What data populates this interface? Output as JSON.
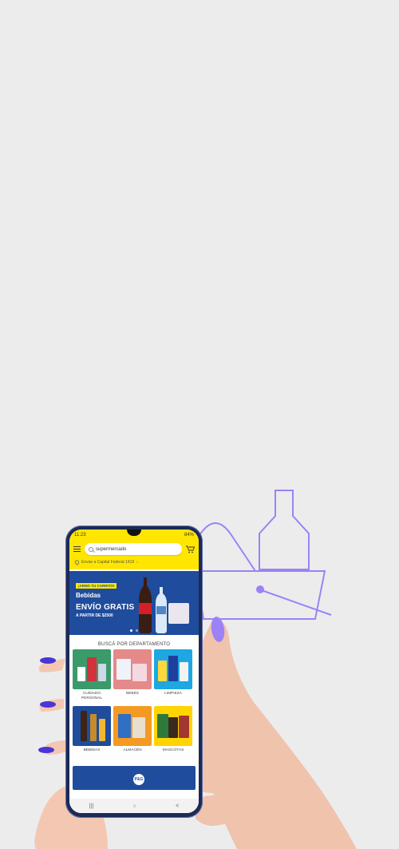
{
  "phone": {
    "status": {
      "time": "11:23",
      "battery": "84%"
    },
    "search": {
      "value": "supermercado",
      "placeholder": ""
    },
    "address": "Enviar a Capital Federal 1419",
    "banner": {
      "tag": "¡ARMÁ TU CARRITO!",
      "title": "Bebidas",
      "headline": "ENVÍO GRATIS",
      "subline": "A PARTIR DE $2500",
      "slide_active": 1,
      "slide_count": 2
    },
    "departments": {
      "title": "BUSCÁ POR DEPARTAMENTO",
      "items": [
        {
          "label": "CUIDADO PERSONAL",
          "color": "#3a9a6a"
        },
        {
          "label": "BEBÉS",
          "color": "#e48a8a"
        },
        {
          "label": "LIMPIEZA",
          "color": "#1ea7e0"
        },
        {
          "label": "BEBIDAS",
          "color": "#1f4c9c"
        },
        {
          "label": "ALMACÉN",
          "color": "#f49a23"
        },
        {
          "label": "MASCOTAS",
          "color": "#ffd400"
        }
      ]
    },
    "promo_brand": "P&G",
    "navbar": {
      "recent": "|||",
      "home": "○",
      "back": "<"
    }
  },
  "colors": {
    "brand_yellow": "#ffe600",
    "brand_blue": "#1f4c9c",
    "accent_purple": "#9d82f5"
  }
}
